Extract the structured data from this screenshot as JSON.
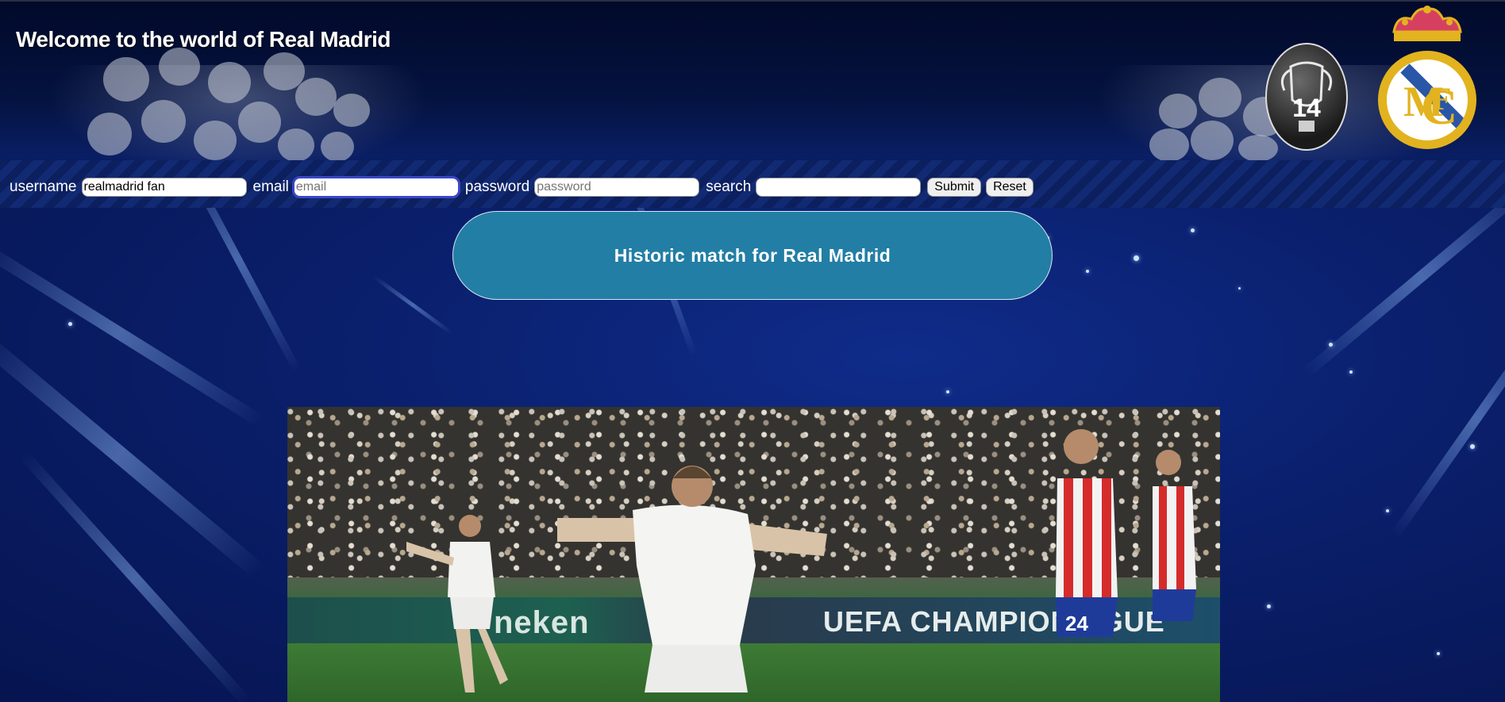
{
  "header": {
    "title": "Welcome to the world of Real Madrid",
    "trophy_number": "14"
  },
  "form": {
    "username_label": "username",
    "username_value": "realmadrid fan",
    "email_label": "email",
    "email_placeholder": "email",
    "password_label": "password",
    "password_placeholder": "password",
    "search_label": "search",
    "search_value": "",
    "submit_label": "Submit",
    "reset_label": "Reset"
  },
  "main": {
    "banner_text": "Historic match for Real Madrid"
  },
  "photo": {
    "board_text_left": "neken",
    "board_text_right": "UEFA CHAMPIONS  GUE",
    "player_number": "24"
  },
  "colors": {
    "banner": "#227ea5",
    "background": "#0a1f6b"
  }
}
